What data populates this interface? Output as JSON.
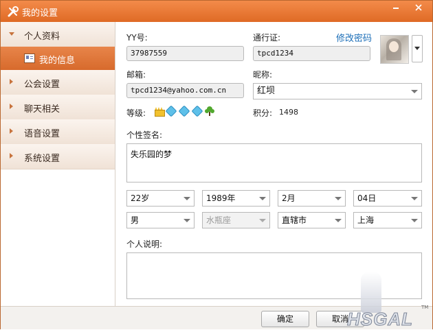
{
  "window": {
    "title": "我的设置"
  },
  "sidebar": {
    "items": [
      {
        "label": "个人资料",
        "expanded": true,
        "children": [
          {
            "label": "我的信息",
            "selected": true
          }
        ]
      },
      {
        "label": "公会设置"
      },
      {
        "label": "聊天相关"
      },
      {
        "label": "语音设置"
      },
      {
        "label": "系统设置"
      }
    ]
  },
  "profile": {
    "yy_label": "YY号:",
    "yy_value": "37987559",
    "passport_label": "通行证:",
    "passport_value": "tpcd1234",
    "change_password": "修改密码",
    "email_label": "邮箱:",
    "email_value": "tpcd1234@yahoo.com.cn",
    "nickname_label": "昵称:",
    "nickname_value": "红坝",
    "level_label": "等级:",
    "level_badges": [
      "crown-icon",
      "diamond-icon",
      "diamond-icon",
      "diamond-icon",
      "tree-icon"
    ],
    "points_label": "积分:",
    "points_value": "1498",
    "signature_label": "个性签名:",
    "signature_value": "失乐园的梦",
    "age": "22岁",
    "birth_year": "1989年",
    "birth_month": "2月",
    "birth_day": "04日",
    "gender": "男",
    "zodiac": "水瓶座",
    "province": "直辖市",
    "city": "上海",
    "intro_label": "个人说明:",
    "intro_value": ""
  },
  "footer": {
    "ok_label": "确定",
    "cancel_label": "取消"
  },
  "watermark": {
    "logo_text": "HSGAL",
    "tm": "TM"
  },
  "colors": {
    "title_bar": "#e9772f",
    "selected_nav": "#e07a3c",
    "link": "#1d6fb8"
  }
}
